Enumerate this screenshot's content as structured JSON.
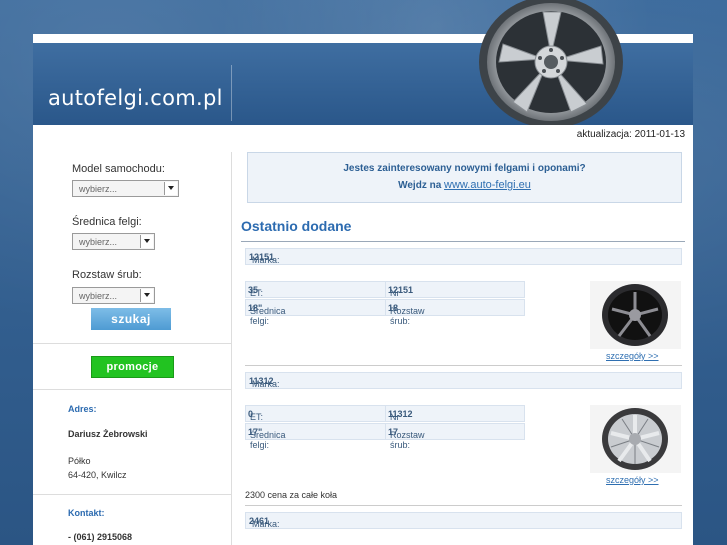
{
  "header": {
    "logo": "autofelgi.com.pl",
    "update_text": "aktualizacja: 2011-01-13"
  },
  "sidebar": {
    "model_label": "Model samochodu:",
    "model_select": "wybierz...",
    "diameter_label": "Średnica felgi:",
    "diameter_select": "wybierz...",
    "bolt_label": "Rozstaw śrub:",
    "bolt_select": "wybierz...",
    "search_button": "szukaj",
    "promo_button": "promocje",
    "address_title": "Adres:",
    "address_name": "Dariusz Żebrowski",
    "address_line1": "Półko",
    "address_line2": "64-420, Kwilcz",
    "contact_title": "Kontakt:",
    "contact_phone": "- (061) 2915068"
  },
  "banner": {
    "line1": "Jestes zainteresowany nowymi felgami i oponami?",
    "line2_prefix": "Wejdz na",
    "line2_link": "www.auto-felgi.eu"
  },
  "main": {
    "section_title": "Ostatnio dodane",
    "labels": {
      "marka": "Marka:",
      "et": "ET:",
      "ident": "Nr IDENT:",
      "diameter": "Średnica felgi:",
      "bolt": "Rozstaw śrub:",
      "details": "szczegóły >>"
    },
    "listings": [
      {
        "marka": "12151",
        "et": "35",
        "ident": "12151",
        "diameter": "18\"",
        "bolt": "18",
        "note": ""
      },
      {
        "marka": "11312",
        "et": "0",
        "ident": "11312",
        "diameter": "17\"",
        "bolt": "17",
        "note": "2300 cena za całe koła"
      },
      {
        "marka": "2461"
      }
    ]
  }
}
